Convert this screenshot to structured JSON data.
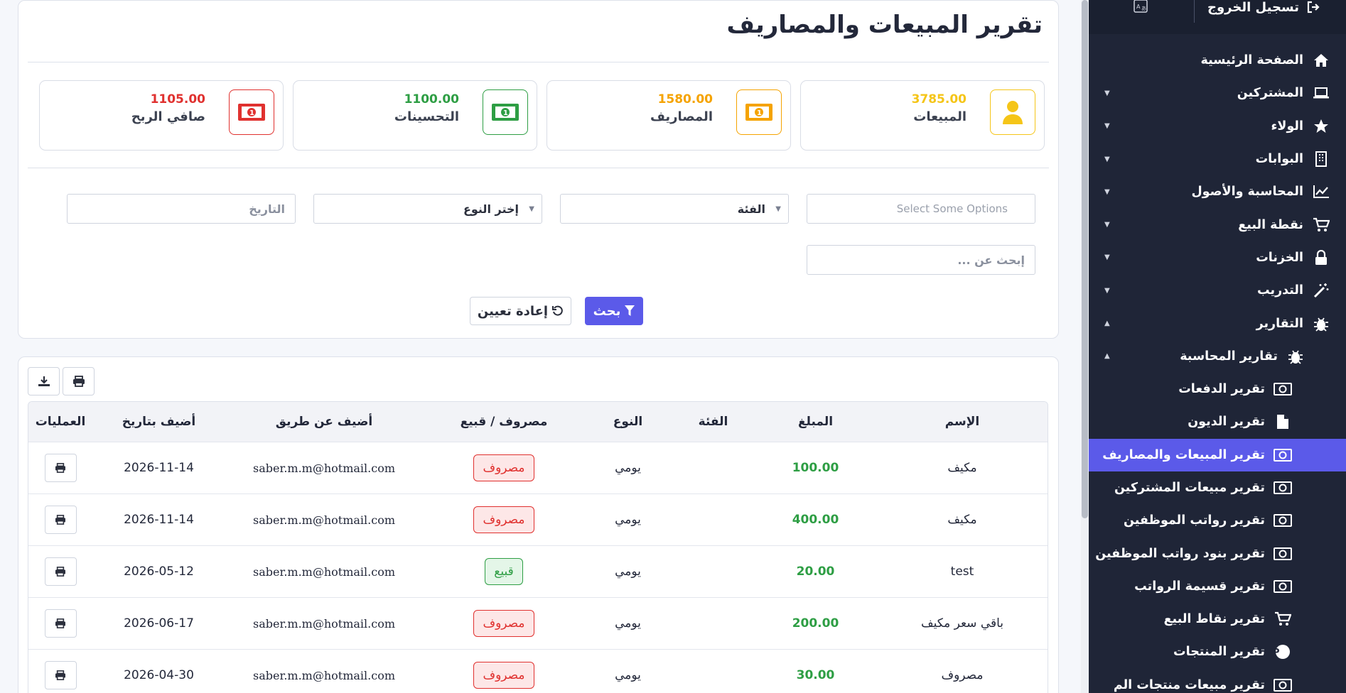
{
  "header": {
    "logout_label": "تسجيل الخروج"
  },
  "sidebar": {
    "items": [
      {
        "label": "الصفحة الرئيسية",
        "icon": "home-icon",
        "caret": ""
      },
      {
        "label": "المشتركين",
        "icon": "laptop-icon",
        "caret": "▼"
      },
      {
        "label": "الولاء",
        "icon": "star-icon",
        "caret": "▼"
      },
      {
        "label": "البوابات",
        "icon": "building-icon",
        "caret": "▼"
      },
      {
        "label": "المحاسبة والأصول",
        "icon": "chart-line-icon",
        "caret": "▼"
      },
      {
        "label": "نقطة البيع",
        "icon": "cart-icon",
        "caret": "▼"
      },
      {
        "label": "الخزنات",
        "icon": "lock-icon",
        "caret": "▼"
      },
      {
        "label": "التدريب",
        "icon": "wand-icon",
        "caret": "▼"
      },
      {
        "label": "التقارير",
        "icon": "bug-icon",
        "caret": "▲"
      },
      {
        "label": "تقارير المحاسبة",
        "icon": "bug-icon",
        "caret": "▲"
      },
      {
        "label": "تقرير الدفعات",
        "icon": "money-icon",
        "caret": ""
      },
      {
        "label": "تقرير الديون",
        "icon": "file-icon",
        "caret": ""
      },
      {
        "label": "تقرير المبيعات والمصاريف",
        "icon": "money-icon",
        "caret": ""
      },
      {
        "label": "تقرير مبيعات المشتركين",
        "icon": "money-icon",
        "caret": ""
      },
      {
        "label": "تقرير رواتب الموظفين",
        "icon": "money-icon",
        "caret": ""
      },
      {
        "label": "تقرير بنود رواتب الموظفين",
        "icon": "money-icon",
        "caret": ""
      },
      {
        "label": "تقرير قسيمة الرواتب",
        "icon": "money-icon",
        "caret": ""
      },
      {
        "label": "تقرير نقاط البيع",
        "icon": "cart-icon",
        "caret": ""
      },
      {
        "label": "تقرير المنتجات",
        "icon": "p-circle-icon",
        "caret": ""
      },
      {
        "label": "تقرير مبيعات منتجات الم",
        "icon": "money-icon",
        "caret": ""
      }
    ]
  },
  "page": {
    "title": "تقرير المبيعات والمصاريف"
  },
  "stats": [
    {
      "value": "3785.00",
      "label": "المبيعات",
      "color": "#f5c518",
      "icon": "user-icon"
    },
    {
      "value": "1580.00",
      "label": "المصاريف",
      "color": "#f5a300",
      "icon": "money-icon"
    },
    {
      "value": "1100.00",
      "label": "التحسينات",
      "color": "#2e9e44",
      "icon": "money-icon"
    },
    {
      "value": "1105.00",
      "label": "صافي الربح",
      "color": "#e0312f",
      "icon": "money-icon"
    }
  ],
  "filters": {
    "options_placeholder": "Select Some Options",
    "category_label": "الفئة",
    "type_label": "إختر النوع",
    "date_placeholder": "التاريخ",
    "search_placeholder": "إبحث عن ..."
  },
  "buttons": {
    "search": "بحث",
    "reset": "إعادة تعيين"
  },
  "table": {
    "columns": [
      "الإسم",
      "المبلغ",
      "الفئة",
      "النوع",
      "مصروف / قبيع",
      "أضيف عن طريق",
      "أضيف بتاريخ",
      "العمليات"
    ],
    "rows": [
      {
        "name": "مكيف",
        "amount": "100.00",
        "category": "",
        "type": "يومي",
        "kind": "مصروف",
        "added_by": "saber.m.m@hotmail.com",
        "date": "2026-11-14"
      },
      {
        "name": "مكيف",
        "amount": "400.00",
        "category": "",
        "type": "يومي",
        "kind": "مصروف",
        "added_by": "saber.m.m@hotmail.com",
        "date": "2026-11-14"
      },
      {
        "name": "test",
        "amount": "20.00",
        "category": "",
        "type": "يومي",
        "kind": "قبيع",
        "added_by": "saber.m.m@hotmail.com",
        "date": "2026-05-12"
      },
      {
        "name": "باقي سعر مكيف",
        "amount": "200.00",
        "category": "",
        "type": "يومي",
        "kind": "مصروف",
        "added_by": "saber.m.m@hotmail.com",
        "date": "2026-06-17"
      },
      {
        "name": "مصروف",
        "amount": "30.00",
        "category": "",
        "type": "يومي",
        "kind": "مصروف",
        "added_by": "saber.m.m@hotmail.com",
        "date": "2026-04-30"
      }
    ]
  }
}
